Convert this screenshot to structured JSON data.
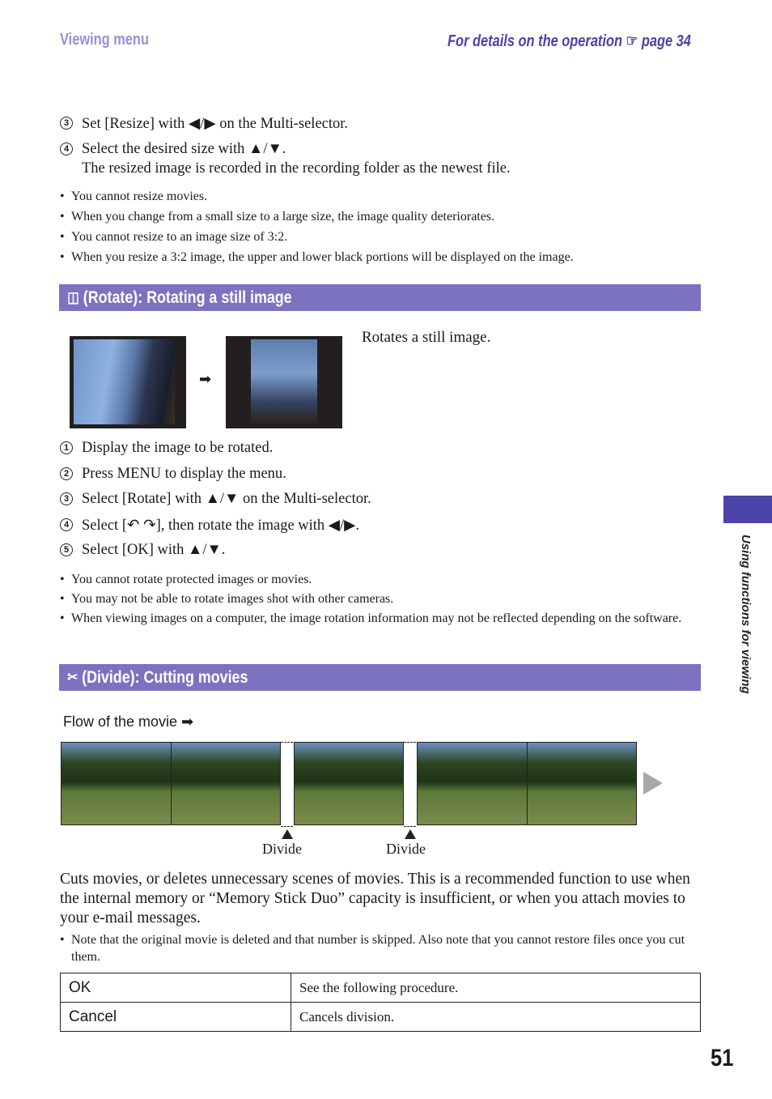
{
  "header": {
    "section": "Viewing menu",
    "details_text": "For details on the operation",
    "details_icon": "pointing-hand-icon",
    "details_page": "page 34"
  },
  "resize_steps": [
    {
      "num": "3",
      "text": "Set [Resize] with ◀/▶ on the Multi-selector."
    },
    {
      "num": "4",
      "text": "Select the desired size with ▲/▼.",
      "subtext": "The resized image is recorded in the recording folder as the newest file."
    }
  ],
  "resize_notes": [
    "You cannot resize movies.",
    "When you change from a small size to a large size, the image quality deteriorates.",
    "You cannot resize to an image size of 3:2.",
    "When you resize a 3:2 image, the upper and lower black portions will be displayed on the image."
  ],
  "rotate": {
    "title": "(Rotate): Rotating a still image",
    "icon": "rotate-icon",
    "description": "Rotates a still image.",
    "steps": [
      {
        "num": "1",
        "text": "Display the image to be rotated."
      },
      {
        "num": "2",
        "text": "Press MENU to display the menu."
      },
      {
        "num": "3",
        "text": "Select [Rotate] with ▲/▼ on the Multi-selector."
      },
      {
        "num": "4",
        "text": "Select [↶ ↷], then rotate the image with ◀/▶."
      },
      {
        "num": "5",
        "text": "Select [OK] with ▲/▼."
      }
    ],
    "notes": [
      "You cannot rotate protected images or movies.",
      "You may not be able to rotate images shot with other cameras.",
      "When viewing images on a computer, the image rotation information may not be reflected depending on the software."
    ]
  },
  "divide": {
    "title": "(Divide): Cutting movies",
    "icon": "scissors-icon",
    "flow_label": "Flow of the movie ➡",
    "divide_label": "Divide",
    "description": "Cuts movies, or deletes unnecessary scenes of movies. This is a recommended function to use when the internal memory or “Memory Stick Duo” capacity is insufficient, or when you attach movies to your e-mail messages.",
    "notes": [
      "Note that the original movie is deleted and that number is skipped. Also note that you cannot restore files once you cut them."
    ],
    "options": [
      {
        "key": "OK",
        "value": "See the following procedure."
      },
      {
        "key": "Cancel",
        "value": "Cancels division."
      }
    ]
  },
  "side_tab": "Using functions for viewing",
  "page_number": "51",
  "colors": {
    "accent": "#7b73c0",
    "header_blue": "#4b43a8",
    "header_light": "#9a8ed6"
  }
}
